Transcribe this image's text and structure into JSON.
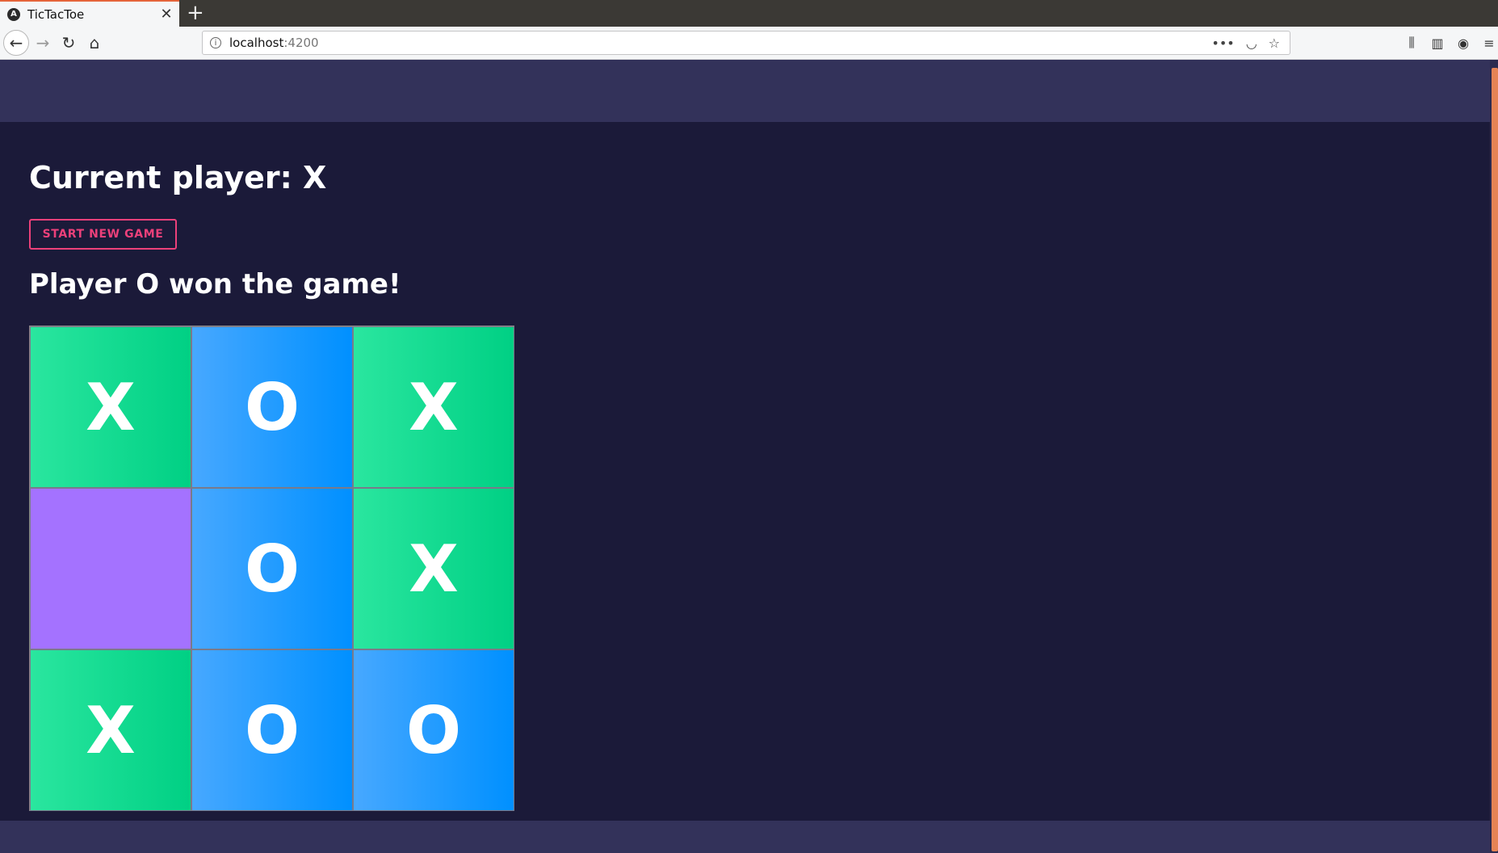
{
  "browser": {
    "tab_title": "TicTacToe",
    "tab_favicon": "A",
    "close_glyph": "✕",
    "new_tab_glyph": "+",
    "url_host": "localhost",
    "url_port": ":4200",
    "icons": {
      "back": "←",
      "forward": "→",
      "reload": "↻",
      "home": "⌂",
      "info": "i",
      "more": "•••",
      "pocket": "◡",
      "bookmark": "☆",
      "library": "⫼",
      "sidebar": "▥",
      "account": "◉",
      "menu": "≡"
    }
  },
  "game": {
    "current_player": "Current player: X",
    "new_game_label": "START NEW GAME",
    "status": "Player O won the game!",
    "board": [
      "X",
      "O",
      "X",
      "",
      "O",
      "X",
      "X",
      "O",
      "O"
    ]
  },
  "colors": {
    "accent": "#ec407a",
    "x_cell": "#00d084",
    "o_cell": "#0090ff",
    "empty_cell": "#a472ff",
    "background": "#1b1a39",
    "header": "#33325a"
  }
}
